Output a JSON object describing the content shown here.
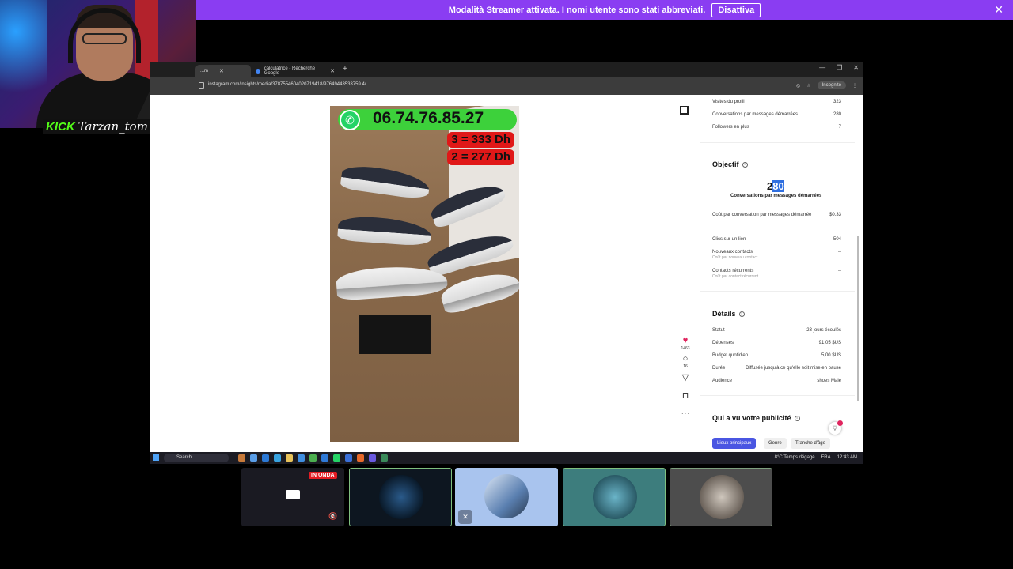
{
  "streamer_banner": {
    "message": "Modalità Streamer attivata. I nomi utente sono stati abbreviati.",
    "button": "Disattiva",
    "close": "✕"
  },
  "webcam": {
    "brand": "KICK",
    "username": "Tarzan_tom"
  },
  "browser": {
    "tabs": [
      {
        "label": "...m",
        "active": true
      },
      {
        "label": "calculatrice - Recherche Google",
        "active": false
      }
    ],
    "new_tab": "+",
    "window_controls": [
      "—",
      "❐",
      "✕"
    ],
    "url": "instagram.com/insights/media/3787554604020719418/97649443533759 4/",
    "incognito_label": "Incognito"
  },
  "post": {
    "phone": "06.74.76.85.27",
    "prices": [
      "3 = 333 Dh",
      "2 = 277 Dh"
    ],
    "likes": "1463",
    "comments": "16"
  },
  "insights": {
    "top_rows": [
      {
        "label": "Visites du profil",
        "value": "323"
      },
      {
        "label": "Conversations par messages démarrées",
        "value": "280"
      },
      {
        "label": "Followers en plus",
        "value": "7"
      }
    ],
    "objective": {
      "title": "Objectif",
      "value_prefix": "2",
      "value_highlight": "80",
      "value_label": "Conversations par messages démarrées",
      "cost_label": "Coût par conversation par messages démarrée",
      "cost_value": "$0.33"
    },
    "metrics": [
      {
        "label": "Clics sur un lien",
        "sub": "",
        "value": "504"
      },
      {
        "label": "Nouveaux contacts",
        "sub": "Coût par nouveau contact",
        "value": "--"
      },
      {
        "label": "Contacts récurrents",
        "sub": "Coût par contact récurrent",
        "value": "--"
      }
    ],
    "details": {
      "title": "Détails",
      "rows": [
        {
          "label": "Statut",
          "value": "23 jours écoulés"
        },
        {
          "label": "Dépenses",
          "value": "91,05 $US"
        },
        {
          "label": "Budget quotidien",
          "value": "5,00 $US"
        },
        {
          "label": "Durée",
          "value": "Diffusée jusqu'à ce qu'elle soit mise en pause"
        },
        {
          "label": "Audience",
          "value": "shoes Male"
        }
      ]
    },
    "audience": {
      "title": "Qui a vu votre publicité",
      "filters": [
        "Lieux principaux",
        "Genre",
        "Tranche d'âge"
      ]
    }
  },
  "taskbar": {
    "search": "Search",
    "weather": "8°C Temps dégagé",
    "lang": "FRA",
    "time": "12:43 AM"
  },
  "participants": {
    "live_badge": "IN ONDA"
  },
  "colors": {
    "streamer_purple": "#8a3df2",
    "whatsapp_green": "#3dd13b",
    "price_red": "#e01818",
    "active_pill": "#4a56e2"
  }
}
